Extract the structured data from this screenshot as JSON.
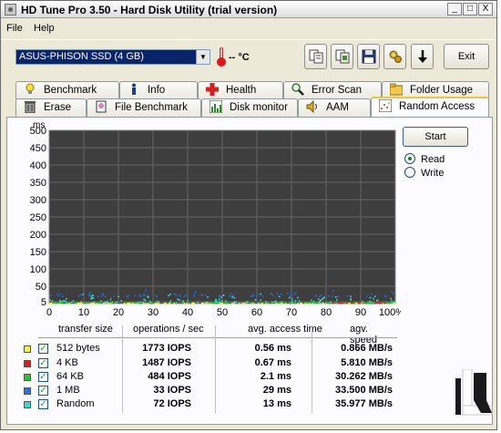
{
  "window": {
    "title": "HD Tune Pro 3.50 - Hard Disk Utility (trial version)",
    "controls": [
      "_",
      "□",
      "X"
    ]
  },
  "menu": [
    {
      "label": "File"
    },
    {
      "label": "Help"
    }
  ],
  "toolbar": {
    "device": "ASUS-PHISON SSD (4 GB)",
    "temperature": "-- °C",
    "icons": [
      "copy-info-icon",
      "copy-screenshot-icon",
      "save-icon",
      "options-icon",
      "download-icon"
    ],
    "exit_label": "Exit"
  },
  "tabs_row1": [
    {
      "label": "Benchmark",
      "icon": "bulb-icon"
    },
    {
      "label": "Info",
      "icon": "info-icon"
    },
    {
      "label": "Health",
      "icon": "health-cross-icon"
    },
    {
      "label": "Error Scan",
      "icon": "magnifier-icon"
    },
    {
      "label": "Folder Usage",
      "icon": "folder-icon"
    }
  ],
  "tabs_row2": [
    {
      "label": "Erase",
      "icon": "trash-icon"
    },
    {
      "label": "File Benchmark",
      "icon": "file-benchmark-icon"
    },
    {
      "label": "Disk monitor",
      "icon": "disk-monitor-icon"
    },
    {
      "label": "AAM",
      "icon": "speaker-icon"
    },
    {
      "label": "Random Access",
      "icon": "random-access-icon",
      "active": true
    }
  ],
  "controls": {
    "start_label": "Start",
    "read_label": "Read",
    "write_label": "Write",
    "selected": "Read"
  },
  "chart_data": {
    "type": "scatter",
    "ylabel": "ms",
    "ylim": [
      0,
      500
    ],
    "yticks": [
      5,
      50,
      100,
      150,
      200,
      250,
      300,
      350,
      400,
      450,
      500
    ],
    "xlim": [
      0,
      100
    ],
    "xticks": [
      "0",
      "10",
      "20",
      "30",
      "40",
      "50",
      "60",
      "70",
      "80",
      "90",
      "100%"
    ],
    "background": "#3e3e3e",
    "grid": true,
    "series": [
      {
        "name": "512 bytes",
        "color": "#e8e840",
        "y_range": [
          0.3,
          1.0
        ],
        "x_range": [
          0,
          100
        ]
      },
      {
        "name": "4 KB",
        "color": "#d02020",
        "y_range": [
          0.4,
          1.2
        ],
        "x_range": [
          82,
          97
        ]
      },
      {
        "name": "64 KB",
        "color": "#20c020",
        "y_range": [
          1.5,
          3.0
        ],
        "x_range": [
          0,
          100
        ]
      },
      {
        "name": "1 MB",
        "color": "#2070e0",
        "y_range": [
          20,
          40
        ],
        "x_range": [
          0,
          100
        ]
      },
      {
        "name": "Random",
        "color": "#40e0e0",
        "y_range": [
          3,
          30
        ],
        "x_range": [
          0,
          100
        ]
      }
    ]
  },
  "results": {
    "headers": [
      "transfer size",
      "operations / sec",
      "avg. access time",
      "agv. speed"
    ],
    "rows": [
      {
        "size": "512 bytes",
        "color": "#f4f04a",
        "ops": "1773 IOPS",
        "access": "0.56 ms",
        "speed": "0.866 MB/s"
      },
      {
        "size": "4 KB",
        "color": "#d42121",
        "ops": "1487 IOPS",
        "access": "0.67 ms",
        "speed": "5.810 MB/s"
      },
      {
        "size": "64 KB",
        "color": "#2fbf2f",
        "ops": "484 IOPS",
        "access": "2.1 ms",
        "speed": "30.262 MB/s"
      },
      {
        "size": "1 MB",
        "color": "#2c70d8",
        "ops": "33 IOPS",
        "access": "29 ms",
        "speed": "33.500 MB/s"
      },
      {
        "size": "Random",
        "color": "#3ad7d7",
        "ops": "72 IOPS",
        "access": "13 ms",
        "speed": "35.977 MB/s"
      }
    ]
  },
  "colors": {
    "window_bg": "#ece9d8",
    "panel_bg": "#fcfcfe",
    "chart_bg": "#3e3e3e",
    "grid": "#6a6a6a",
    "selection": "#0a246a"
  },
  "logo": {
    "icon": "legit-reviews-logo"
  }
}
